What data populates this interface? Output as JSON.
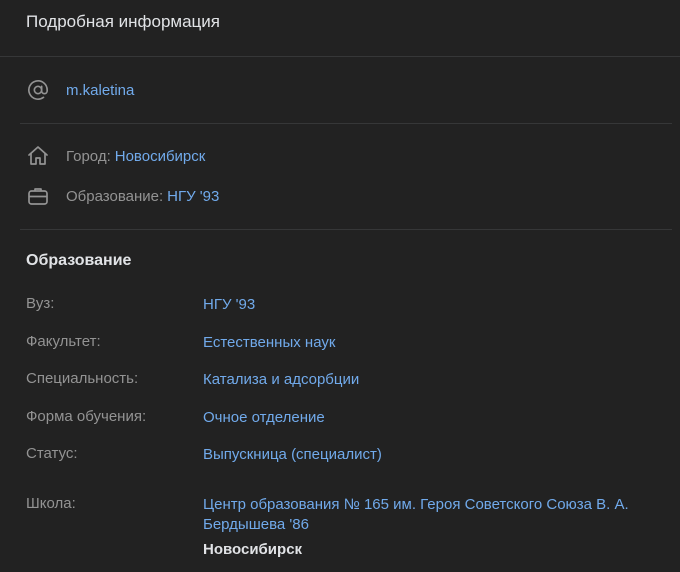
{
  "header": {
    "title": "Подробная информация"
  },
  "contact": {
    "username": "m.kaletina",
    "icon": "at-sign-icon"
  },
  "basic": {
    "city_label": "Город:",
    "city_value": "Новосибирск",
    "education_label": "Образование:",
    "education_value": "НГУ '93"
  },
  "education": {
    "title": "Образование",
    "rows": [
      {
        "key": "Вуз:",
        "value": "НГУ '93"
      },
      {
        "key": "Факультет:",
        "value": "Естественных наук"
      },
      {
        "key": "Специальность:",
        "value": "Катализа и адсорбции"
      },
      {
        "key": "Форма обучения:",
        "value": "Очное отделение"
      },
      {
        "key": "Статус:",
        "value": "Выпускница (специалист)"
      }
    ],
    "school": {
      "key": "Школа:",
      "value": "Центр образования № 165 им. Героя Советского Союза В. А. Бердышева '86",
      "city": "Новосибирск"
    }
  },
  "colors": {
    "background": "#222222",
    "link": "#71aaeb",
    "muted": "#939393",
    "text": "#e1e3e6",
    "divider": "#363738"
  }
}
